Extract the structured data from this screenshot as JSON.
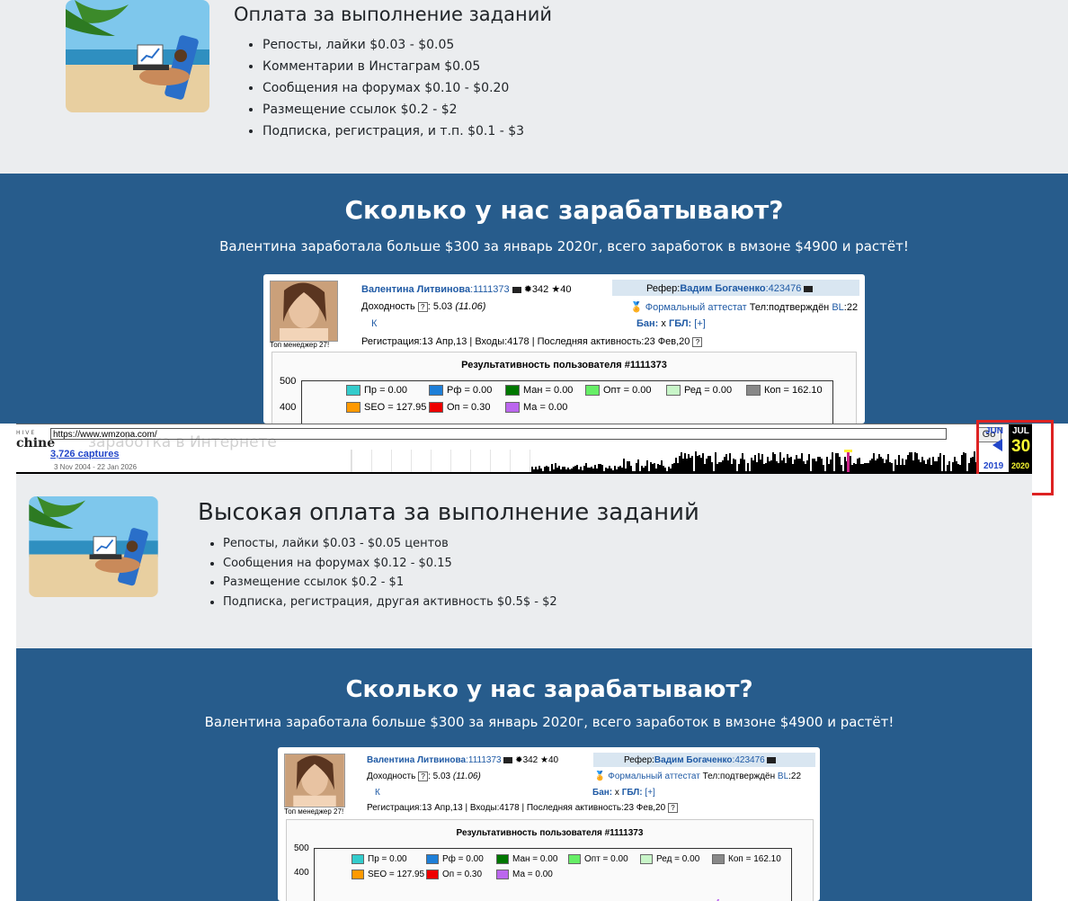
{
  "top_panel": {
    "title": "Оплата за выполнение заданий",
    "items": [
      "Репосты, лайки $0.03 - $0.05",
      "Комментарии в Инстаграм $0.05",
      "Сообщения на форумах $0.10 - $0.20",
      "Размещение ссылок $0.2 - $2",
      "Подписка, регистрация, и т.п. $0.1 - $3"
    ]
  },
  "blue_section": {
    "title": "Сколько у нас зарабатывают?",
    "subtitle": "Валентина заработала больше $300 за январь 2020г, всего заработок в вмзоне $4900 и растёт!"
  },
  "card": {
    "photo_caption": "Топ менеджер 27!",
    "user_name": "Валентина Литвинова",
    "user_id": ":1111373",
    "badge_count": "342",
    "star_count": "40",
    "referrer_label": "Рефер:",
    "referrer_name": "Вадим Богаченко",
    "referrer_id": ":423476",
    "profit_label": "Доходность",
    "profit_value": ": 5.03",
    "profit_extra": "(11.06)",
    "attest_label": "Формальный аттестат",
    "phone_text": " Тел:подтверждён ",
    "bl_label": "BL",
    "bl_value": ":22",
    "k_label": "К",
    "ban_label": "Бан:",
    "ban_value": " х ",
    "gbl_label": "ГБЛ:",
    "gbl_value": " [+]",
    "reg_text": "Регистрация:13 Апр,13 | Входы:4178 | Последняя активность:23 Фев,20",
    "q": "?",
    "chart_title": "Результативность пользователя #1111373",
    "y_tick_500": "500",
    "y_tick_400": "400",
    "legend": [
      {
        "label": "Пр = 0.00",
        "color": "#33cccc"
      },
      {
        "label": "Рф = 0.00",
        "color": "#1e7fd8"
      },
      {
        "label": "Ман = 0.00",
        "color": "#007700"
      },
      {
        "label": "Опт = 0.00",
        "color": "#66ee66"
      },
      {
        "label": "Ред = 0.00",
        "color": "#c8f5c8"
      },
      {
        "label": "Коп = 162.10",
        "color": "#888888"
      },
      {
        "label": "SEO = 127.95",
        "color": "#ff9900"
      },
      {
        "label": "Оп = 0.30",
        "color": "#ee0000"
      },
      {
        "label": "Ма = 0.00",
        "color": "#bb66ee"
      }
    ]
  },
  "wayback": {
    "url": "https://www.wmzona.com/",
    "go_label": "Go",
    "captures": "3,726 captures",
    "date_range": "3 Nov 2004 - 22 Jan 2026",
    "logo_top": "HIVE",
    "logo_bottom": "chine",
    "ghost_text": "заработка в Интернете",
    "prev_month": "JUN",
    "prev_year": "2019",
    "cur_month": "JUL",
    "cur_day": "30",
    "cur_year": "2020",
    "highlight_color": "#dd2222"
  },
  "second_panel": {
    "title": "Высокая оплата за выполнение заданий",
    "items": [
      "Репосты, лайки $0.03 - $0.05 центов",
      "Сообщения на форумах $0.12 - $0.15",
      "Размещение ссылок $0.2 - $1",
      "Подписка, регистрация, другая активность $0.5$ - $2"
    ]
  },
  "second_blue": {
    "title": "Сколько у нас зарабатывают?",
    "subtitle": "Валентина заработала больше $300 за январь 2020г, всего заработок в вмзоне $4900 и растёт!"
  }
}
